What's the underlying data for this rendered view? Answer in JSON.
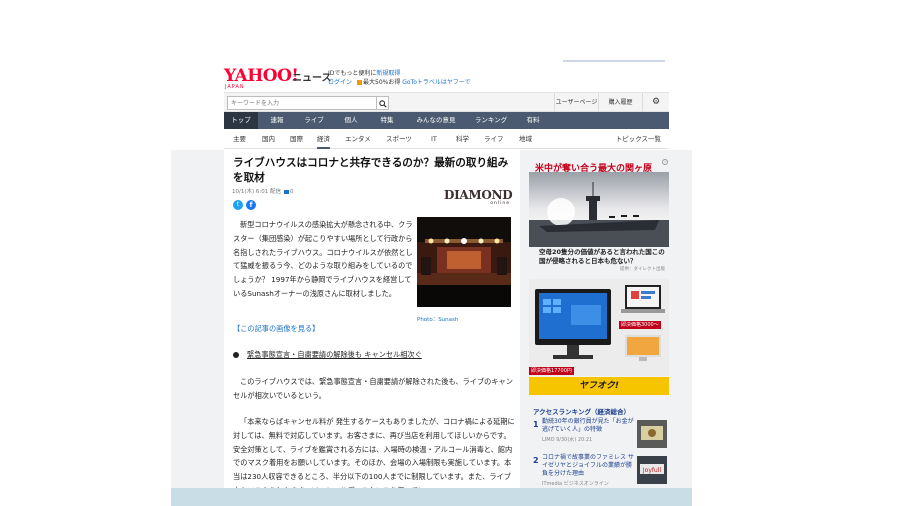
{
  "header": {
    "logo": "YAHOO!",
    "logo_sub": "JAPAN",
    "section": "ニュース",
    "promo1_prefix": "IDでもっと便利に",
    "promo1_link": "新規取得",
    "promo2_login": "ログイン",
    "promo2_deal": "最大50%お得",
    "promo2_goto": "GoToトラベルはヤフーで"
  },
  "search": {
    "placeholder": "キーワードを入力",
    "icon": "search-icon"
  },
  "utility": {
    "user_page": "ユーザーページ",
    "purchase_history": "購入履歴",
    "gear": "⚙"
  },
  "nav": {
    "items": [
      {
        "label": "トップ",
        "active": true
      },
      {
        "label": "速報"
      },
      {
        "label": "ライブ"
      },
      {
        "label": "個人"
      },
      {
        "label": "特集"
      },
      {
        "label": "みんなの意見"
      },
      {
        "label": "ランキング"
      },
      {
        "label": "有料"
      }
    ]
  },
  "subnav": {
    "items": [
      {
        "label": "主要"
      },
      {
        "label": "国内"
      },
      {
        "label": "国際"
      },
      {
        "label": "経済",
        "active": true
      },
      {
        "label": "エンタメ"
      },
      {
        "label": "スポーツ"
      },
      {
        "label": "IT"
      },
      {
        "label": "科学"
      },
      {
        "label": "ライフ"
      },
      {
        "label": "地域"
      }
    ],
    "right": "トピックス一覧"
  },
  "article": {
    "title": "ライブハウスはコロナと共存できるのか？最新の取り組みを取材",
    "meta_date": "10/1(木) 6:01 配信",
    "comment_count": "0",
    "publisher_logo": "DIAMOND",
    "publisher_sub": "online",
    "body": "新型コロナウイルスの感染拡大が懸念される中、クラスター（集団感染）が起こりやすい場所として行政から名指しされたライブハウス。コロナウイルスが依然として猛威を振るう今、どのような取り組みをしているのでしょうか？ 1997年から静岡でライブハウスを経営しているSunashオーナーの浅原さんに取材しました。",
    "photo_credit": "Photo：Sunash",
    "photos_link": "【この記事の画像を見る】",
    "bullet": "緊急事態宣言・自粛要請の解除後も キャンセル相次ぐ",
    "para2": "このライブハウスでは、緊急事態宣言・自粛要請が解除された後も、ライブのキャンセルが相次いでいるという。",
    "para3": "「本来ならばキャンセル料が 発生するケースもありましたが、コロナ禍による延期に対しては、無料で対応しています。お客さまに、再び当店を利用してほしいからです。安全対策として、ライブを鑑賞される方には、入場時の検温・アルコール消毒と、館内でのマスク着用をお願いしています。そのほか、会場の入場制限も実施しています。本当は230人収容できるところ、半分以下の100人までに制限しています。また、ライブ中もマスクをしたまま、ソーシャルディスタンスを保ってい"
  },
  "sidebar": {
    "ad_title": "米中が奪い合う最大の関ヶ原",
    "ad_caption": "空母20隻分の価値があると言われた国この国が侵略されると日本も危ない？",
    "ad_sponsor": "提供：ダイレクト出版",
    "price1": "即決価格3000〜",
    "price2": "即決価格17700円",
    "yahuoku": "ヤフオク!",
    "ranking_title": "アクセスランキング（経済総合）",
    "ranking": [
      {
        "num": "1",
        "text": "勤続30年の銀行員が見た「お金が逃げていく人」の特徴",
        "source": "LIMO 9/30(水) 20:21"
      },
      {
        "num": "2",
        "text": "コロナ禍で故事業のファミレス サイゼリヤとジョイフルの業績が勝負を分けた理由",
        "source": "ITmedia ビジネスオンライン"
      }
    ]
  },
  "colors": {
    "brand_red": "#ff0033",
    "nav_bg": "#4b5a70",
    "link_blue": "#1a73c8",
    "ad_red": "#c4001a"
  }
}
